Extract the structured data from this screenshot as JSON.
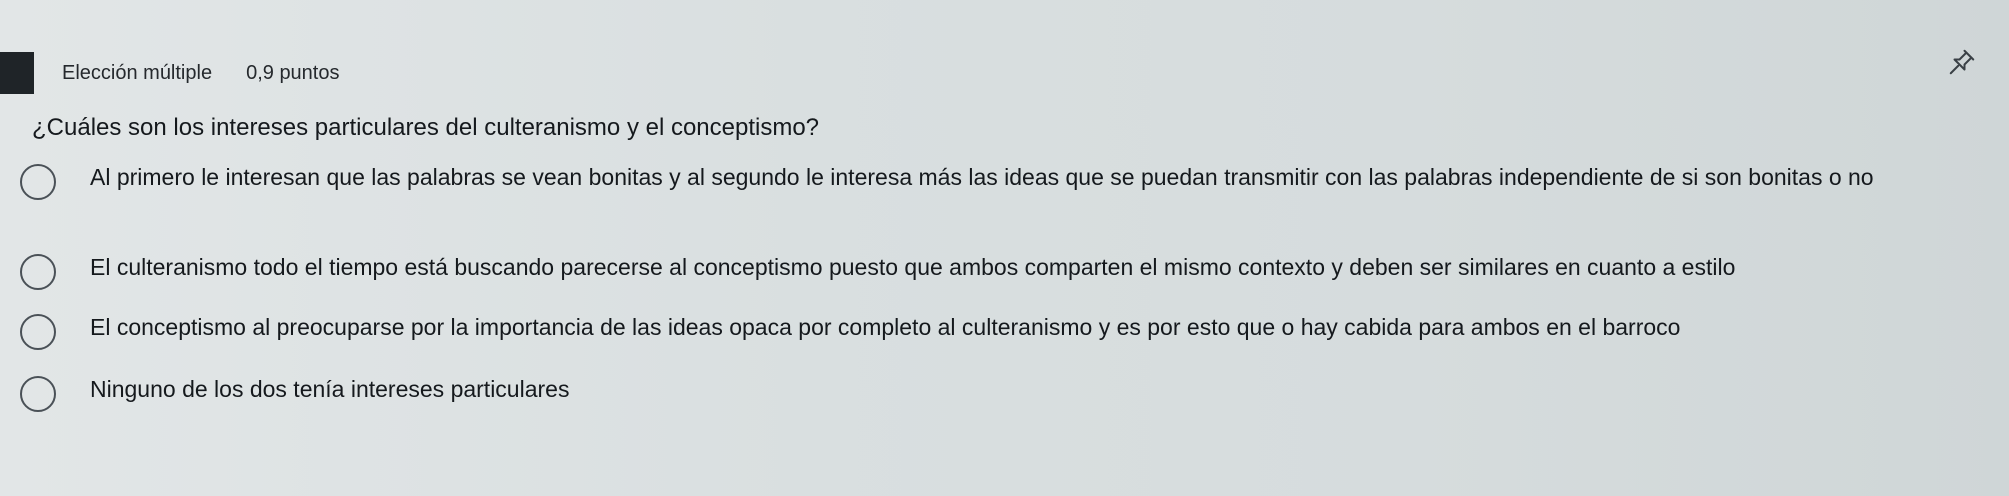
{
  "header": {
    "type_label": "Elección múltiple",
    "points_label": "0,9 puntos"
  },
  "icons": {
    "pin": "pin-icon"
  },
  "question": {
    "text": "¿Cuáles son los intereses particulares del culteranismo y el conceptismo?"
  },
  "options": [
    {
      "text": "Al primero le interesan que las palabras se vean bonitas y al segundo le interesa más las ideas que se puedan transmitir con las palabras independiente de si son bonitas o no",
      "selected": false
    },
    {
      "text": "El culteranismo todo el tiempo está buscando parecerse al conceptismo puesto que ambos comparten el mismo contexto y deben ser similares en cuanto a estilo",
      "selected": false
    },
    {
      "text": "El conceptismo al preocuparse por la importancia de las ideas opaca por completo al culteranismo y es por esto que o hay cabida para ambos en el barroco",
      "selected": false
    },
    {
      "text": "Ninguno de los dos tenía intereses particulares",
      "selected": false
    }
  ],
  "colors": {
    "background": "#dde2e3",
    "text": "#15191d",
    "radio_border": "#4a5157",
    "left_bar": "#1f2428"
  }
}
